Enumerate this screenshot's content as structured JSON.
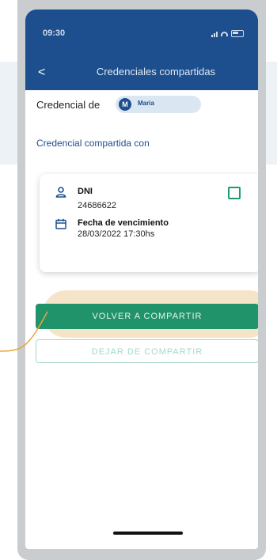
{
  "status": {
    "time": "09:30"
  },
  "nav": {
    "back_glyph": "<",
    "title": "Credenciales compartidas"
  },
  "credential": {
    "label": "Credencial de",
    "user_initial": "M",
    "user_name": "Maria"
  },
  "shared_with_label": "Credencial compartida con",
  "card": {
    "doc_type": "DNI",
    "doc_number": "24686622",
    "expiry_label": "Fecha de vencimiento",
    "expiry_value": "28/03/2022 17:30hs"
  },
  "buttons": {
    "reshare": "VOLVER A COMPARTIR",
    "stop_sharing": "DEJAR DE COMPARTIR"
  },
  "colors": {
    "nav_bg": "#1d4e8e",
    "primary_button": "#21936a",
    "highlight": "#f6e4c9",
    "connector_line": "#e8a73a"
  },
  "icons": {
    "user": "user-icon",
    "calendar": "calendar-icon",
    "checkbox": "checkbox-icon",
    "back": "chevron-left-icon"
  }
}
